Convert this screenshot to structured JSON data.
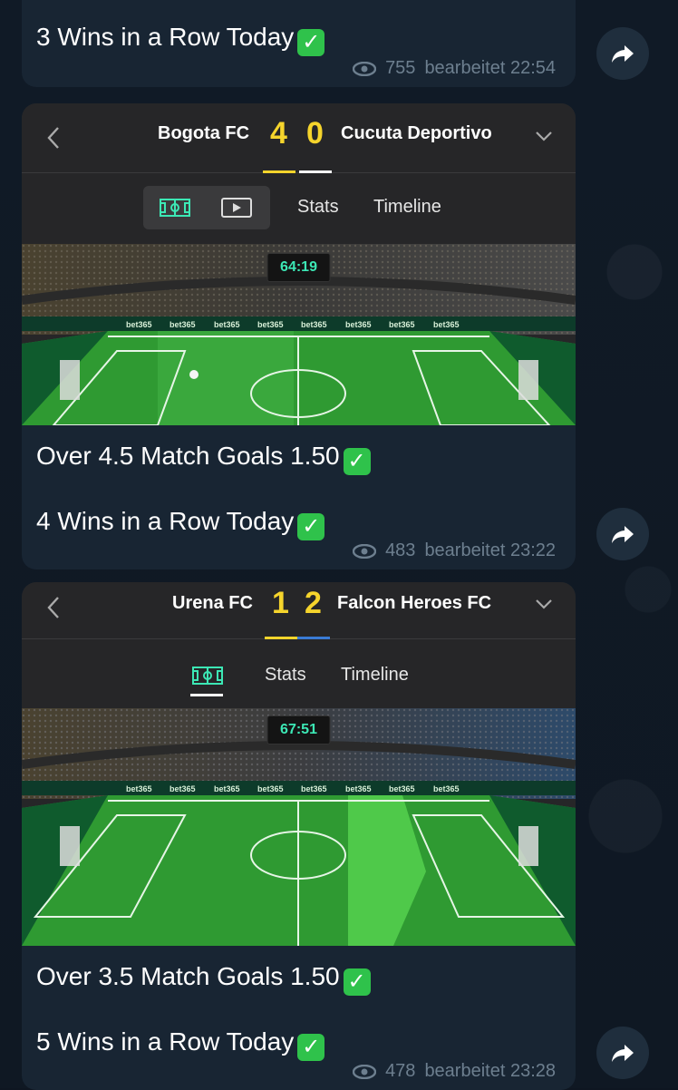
{
  "messages": [
    {
      "text": "3 Wins in a Row Today",
      "views": "755",
      "edited": "bearbeitet 22:54"
    },
    {
      "match": {
        "team_home": "Bogota FC",
        "score_home": "4",
        "score_away": "0",
        "team_away": "Cucuta Deportivo",
        "tab_stats": "Stats",
        "tab_timeline": "Timeline",
        "timer": "64:19"
      },
      "line1": "Over 4.5 Match Goals 1.50",
      "line2": "4 Wins in a Row Today",
      "views": "483",
      "edited": "bearbeitet 23:22"
    },
    {
      "match": {
        "team_home": "Urena FC",
        "score_home": "1",
        "score_away": "2",
        "team_away": "Falcon Heroes FC",
        "tab_stats": "Stats",
        "tab_timeline": "Timeline",
        "timer": "67:51"
      },
      "line1": "Over 3.5 Match Goals 1.50",
      "line2": "5 Wins in a Row Today",
      "views": "478",
      "edited": "bearbeitet 23:28"
    }
  ],
  "icons": {
    "views": "eye-icon",
    "share": "share-icon",
    "back": "chevron-left-icon",
    "expand": "chevron-down-icon",
    "pitch": "pitch-icon",
    "video": "play-icon",
    "check": "check-mark-icon"
  },
  "colors": {
    "score": "#f5d42c",
    "timer": "#3ce8b5",
    "check": "#2fc24b",
    "home_underline": "#f5d42c",
    "away_underline_1": "#ffffff",
    "away_underline_2": "#3a7bd5"
  },
  "ad_board_text": "bet365"
}
